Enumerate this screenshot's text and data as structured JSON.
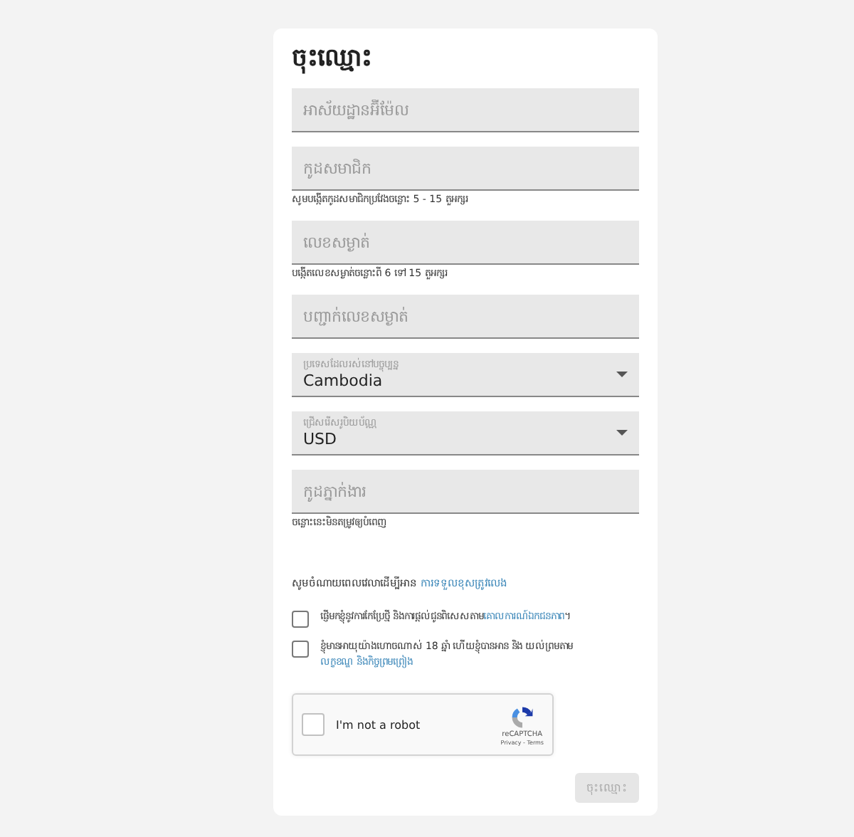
{
  "title": "ចុះឈ្មោះ",
  "fields": [
    {
      "kind": "text",
      "placeholder": "អាស័យដ្ឋានអ៊ីម៉ែល"
    },
    {
      "kind": "text",
      "placeholder": "កូដសមាជិក",
      "hint": "សូមបង្កើតកូដសមាជិកប្រវែងចន្លោះ 5 - 15 តួអក្សរ"
    },
    {
      "kind": "text",
      "placeholder": "លេខសម្ងាត់",
      "hint": "បង្កើតលេខសម្ងាត់ចន្លោះពី 6 ទៅ 15 តួអក្សរ"
    },
    {
      "kind": "text",
      "placeholder": "បញ្ជាក់លេខសម្ងាត់"
    },
    {
      "kind": "select",
      "label": "ប្រទេសដែលរស់នៅបច្ចុប្បន្ន",
      "value": "Cambodia"
    },
    {
      "kind": "select",
      "label": "ជ្រើសរើសរូបិយប័ណ្ណ",
      "value": "USD"
    },
    {
      "kind": "text",
      "placeholder": "កូដភ្នាក់ងារ",
      "hint": "ចន្លោះនេះមិនតម្រូវឲ្យបំពេញ"
    }
  ],
  "notice": {
    "text": "សូមចំណាយពេលវេលាដើម្បីអាន ",
    "link": "ការទទួលខុសត្រូវលេង"
  },
  "checkboxes": [
    {
      "checked": false,
      "text": "ផ្ញើមកខ្ញុំនូវការកែប្រែថ្មី និងការផ្តល់ជូនពិសេសតាម",
      "link": "គោលការណ៍ឯកជនភាព",
      "after": "។"
    },
    {
      "checked": false,
      "text": "ខ្ញុំមានអាយុយ៉ាងហោចណាស់ 18 ឆ្នាំ ហើយខ្ញុំបានអាន និង យល់ព្រមតាម ",
      "link": "លក្ខខណ្ឌ និងកិច្ចព្រមព្រៀង"
    }
  ],
  "captcha": {
    "checked": false,
    "label": "I'm not a robot",
    "brand": "reCAPTCHA",
    "links": "Privacy - Terms"
  },
  "submit": {
    "label": "ចុះឈ្មោះ",
    "disabled": true
  }
}
